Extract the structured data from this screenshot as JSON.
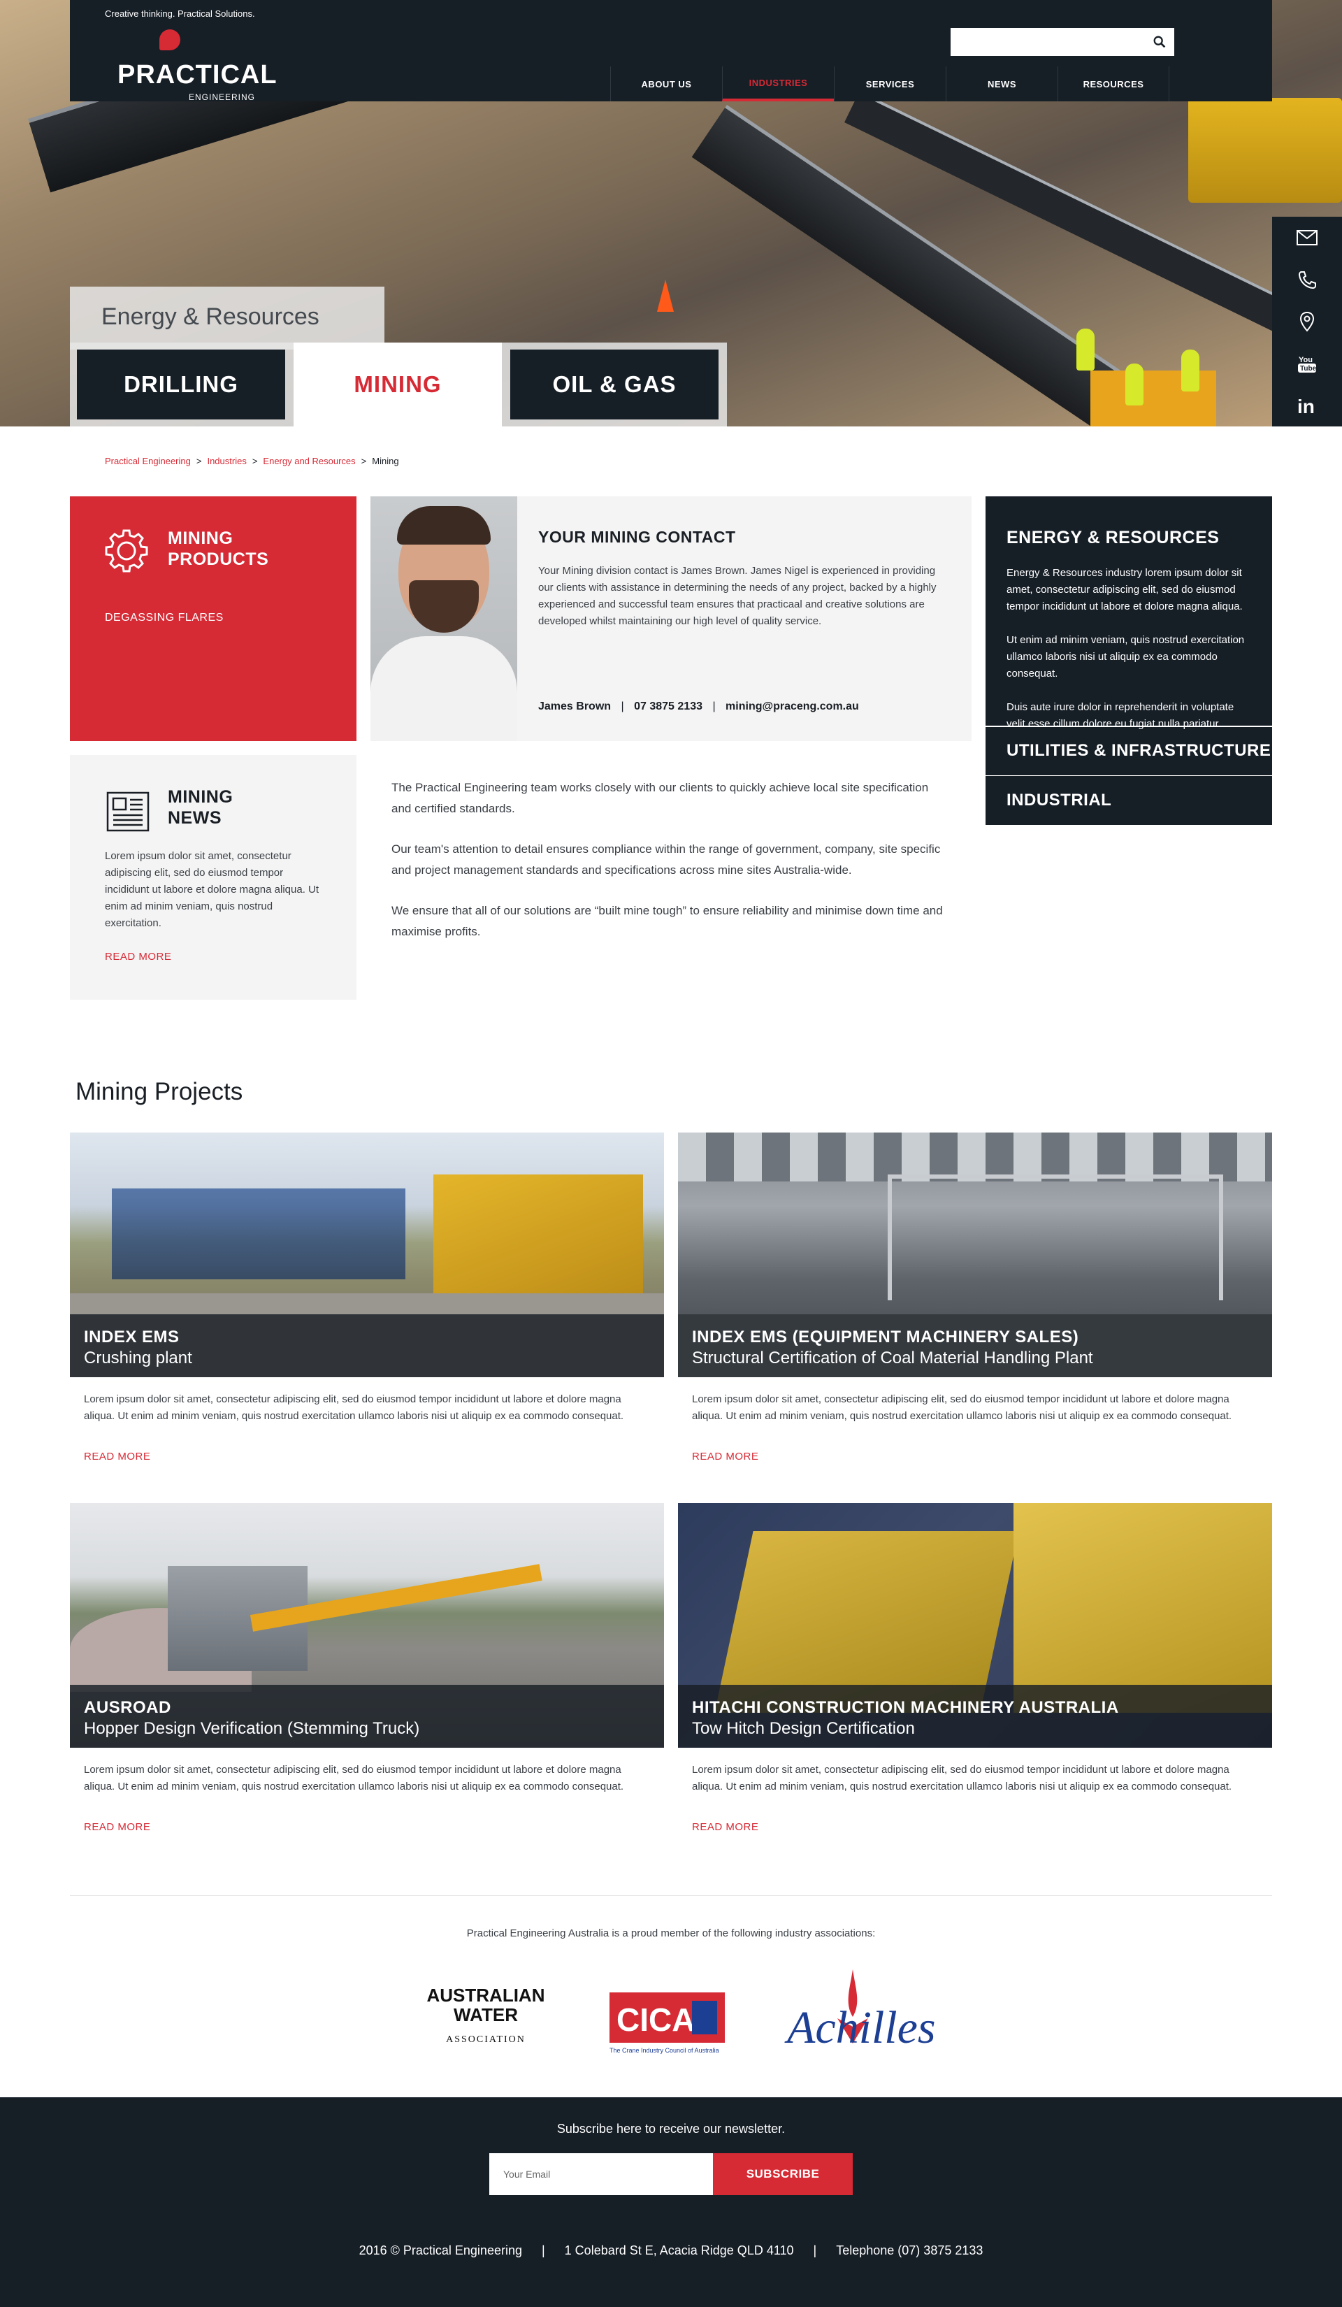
{
  "header": {
    "tagline": "Creative thinking. Practical Solutions.",
    "logo_name": "PRACTICAL",
    "logo_sub": "ENGINEERING",
    "search_placeholder": "",
    "nav": [
      {
        "label": "ABOUT US",
        "active": false
      },
      {
        "label": "INDUSTRIES",
        "active": true
      },
      {
        "label": "SERVICES",
        "active": false
      },
      {
        "label": "NEWS",
        "active": false
      },
      {
        "label": "RESOURCES",
        "active": false
      }
    ]
  },
  "side_icons": [
    "mail-icon",
    "phone-icon",
    "location-icon",
    "youtube-icon",
    "linkedin-icon"
  ],
  "hero": {
    "label": "Energy & Resources",
    "tabs": [
      {
        "label": "DRILLING",
        "active": false
      },
      {
        "label": "MINING",
        "active": true
      },
      {
        "label": "OIL & GAS",
        "active": false
      }
    ]
  },
  "breadcrumb": {
    "items": [
      "Practical Engineering",
      "Industries",
      "Energy and Resources"
    ],
    "current": "Mining",
    "separator": ">"
  },
  "products": {
    "title_l1": "MINING",
    "title_l2": "PRODUCTS",
    "item": "DEGASSING FLARES"
  },
  "contact": {
    "title": "YOUR MINING CONTACT",
    "body": "Your Mining division contact is James Brown. James Nigel is experienced in providing our clients with assistance in determining the needs of any project, backed by a highly experienced and successful team ensures that practicaal and creative solutions are developed whilst maintaining our high level of quality service.",
    "name": "James Brown",
    "phone": "07 3875 2133",
    "email": "mining@praceng.com.au"
  },
  "energy": {
    "title": "ENERGY & RESOURCES",
    "paragraphs": [
      "Energy & Resources industry lorem ipsum dolor sit amet, consectetur adipiscing elit, sed do eiusmod tempor incididunt ut labore et dolore magna aliqua.",
      "Ut enim ad minim veniam, quis nostrud exercitation ullamco laboris nisi ut aliquip ex ea commodo consequat.",
      "Duis aute irure dolor in reprehenderit in voluptate velit esse cillum dolore eu fugiat nulla pariatur."
    ],
    "links": [
      "UTILITIES & INFRASTRUCTURE",
      "INDUSTRIAL"
    ]
  },
  "news": {
    "title_l1": "MINING",
    "title_l2": "NEWS",
    "body": "Lorem ipsum dolor sit amet, consectetur adipiscing elit, sed do eiusmod tempor incididunt ut labore et dolore magna aliqua. Ut enim ad minim veniam, quis nostrud exercitation.",
    "more": "READ MORE"
  },
  "body_text": [
    "The Practical Engineering team works closely with our clients to quickly achieve local site specification and certified standards.",
    "Our team's attention to detail ensures compliance within the range of government, company, site specific and project management standards and specifications across mine sites Australia-wide.",
    "We ensure that all of our solutions are “built mine tough” to ensure reliability and minimise down time and maximise profits."
  ],
  "projects": {
    "title": "Mining Projects",
    "items": [
      {
        "client": "INDEX EMS",
        "name": "Crushing plant",
        "body": "Lorem ipsum dolor sit amet, consectetur adipiscing elit, sed do eiusmod tempor incididunt ut labore et dolore magna aliqua. Ut enim ad minim veniam, quis nostrud exercitation ullamco laboris nisi ut aliquip ex ea commodo consequat.",
        "more": "READ MORE"
      },
      {
        "client": "INDEX EMS (EQUIPMENT MACHINERY SALES)",
        "name": "Structural Certification of Coal Material Handling Plant",
        "body": "Lorem ipsum dolor sit amet, consectetur adipiscing elit, sed do eiusmod tempor incididunt ut labore et dolore magna aliqua. Ut enim ad minim veniam, quis nostrud exercitation ullamco laboris nisi ut aliquip ex ea commodo consequat.",
        "more": "READ MORE"
      },
      {
        "client": "AUSROAD",
        "name": "Hopper Design Verification (Stemming Truck)",
        "body": "Lorem ipsum dolor sit amet, consectetur adipiscing elit, sed do eiusmod tempor incididunt ut labore et dolore magna aliqua. Ut enim ad minim veniam, quis nostrud exercitation ullamco laboris nisi ut aliquip ex ea commodo consequat.",
        "more": "READ MORE"
      },
      {
        "client": "HITACHI CONSTRUCTION MACHINERY AUSTRALIA",
        "name": "Tow Hitch Design Certification",
        "body": "Lorem ipsum dolor sit amet, consectetur adipiscing elit, sed do eiusmod tempor incididunt ut labore et dolore magna aliqua. Ut enim ad minim veniam, quis nostrud exercitation ullamco laboris nisi ut aliquip ex ea commodo consequat.",
        "more": "READ MORE"
      }
    ]
  },
  "associations": {
    "intro": "Practical Engineering Australia is a proud member of the following industry associations:",
    "awa_l1": "AUSTRALIAN",
    "awa_l2": "WATER",
    "awa_l3": "ASSOCIATION",
    "cica": "CICA",
    "cica_caption": "The Crane Industry Council of Australia",
    "achilles": "Achilles"
  },
  "footer": {
    "newsletter": "Subscribe here to receive our newsletter.",
    "email_placeholder": "Your Email",
    "subscribe": "SUBSCRIBE",
    "copyright": "2016 © Practical Engineering",
    "address": "1 Colebard St E, Acacia Ridge QLD 4110",
    "phone": "Telephone (07) 3875 2133",
    "separator": "|"
  },
  "colors": {
    "brand_red": "#d62a35",
    "dark_navy": "#161e26",
    "light_grey": "#f4f4f4"
  }
}
